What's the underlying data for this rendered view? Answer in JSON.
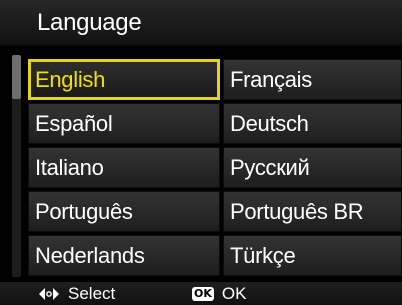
{
  "header": {
    "title": "Language"
  },
  "languages": {
    "left": [
      "English",
      "Español",
      "Italiano",
      "Português",
      "Nederlands"
    ],
    "right": [
      "Français",
      "Deutsch",
      "Русский",
      "Português BR",
      "Türkçe"
    ],
    "selected": "English"
  },
  "footer": {
    "select_label": "Select",
    "ok_icon_text": "OK",
    "ok_label": "OK",
    "select_icon": "dpad-left-right-icon"
  },
  "colors": {
    "selection_highlight": "#e3d31d",
    "selected_text": "#f2e000"
  }
}
